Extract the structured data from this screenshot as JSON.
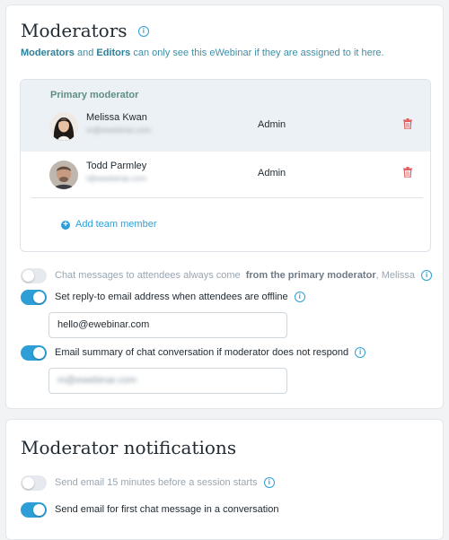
{
  "moderators_section": {
    "title": "Moderators",
    "description": {
      "role1": "Moderators",
      "and": "and",
      "role2": "Editors",
      "rest": "can only see this eWebinar if they are assigned to it here."
    },
    "primary_label": "Primary moderator",
    "moderators": [
      {
        "name": "Melissa Kwan",
        "email": "m@ewebinar.com",
        "role": "Admin"
      },
      {
        "name": "Todd Parmley",
        "email": "t@ewebinar.com",
        "role": "Admin"
      }
    ],
    "add_member_label": "Add team member"
  },
  "settings": {
    "chat_from_primary": {
      "on": false,
      "text_before": "Chat messages to attendees always come",
      "text_strong": "from the primary moderator",
      "text_after": ", Melissa"
    },
    "reply_to": {
      "on": true,
      "label": "Set reply-to email address when attendees are offline",
      "input_value": "hello@ewebinar.com"
    },
    "email_summary": {
      "on": true,
      "label": "Email summary of chat conversation if moderator does not respond",
      "input_value": "m@ewebinar.com"
    }
  },
  "notifications_section": {
    "title": "Moderator notifications",
    "items": [
      {
        "on": false,
        "label": "Send email 15 minutes before a session starts"
      },
      {
        "on": true,
        "label": "Send email for first chat message in a conversation"
      }
    ]
  },
  "colors": {
    "accent": "#2e9fd6",
    "danger": "#e25c5c",
    "primary_label": "#5e8f85"
  },
  "icons": {
    "info": "info-circle-icon",
    "delete": "trash-icon",
    "add": "plus-circle-icon"
  }
}
